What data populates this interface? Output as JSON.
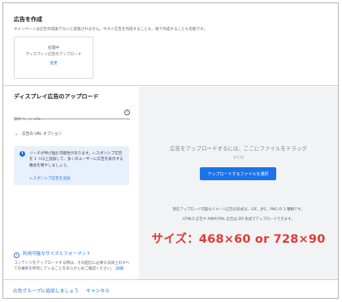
{
  "create_ad": {
    "title": "広告を作成",
    "description": "キャンペーンは広告作成後でないと実施されません。今すぐ広告を作成することも、後で作成することも可能です。",
    "card": {
      "status": "処理中",
      "type": "ディスプレイ広告のアップロード",
      "edit": "変更"
    }
  },
  "upload_panel": {
    "title": "ディスプレイ広告のアップロード",
    "url_placeholder": "最終ページ URL",
    "url_options_label": "広告の URL オプション",
    "info": {
      "text": "リーチが伸び悩む可能性があります。レスポンシブ広告を 1 つ以上追加して、多くのユーザーに広告を表示する機会を増やしましょう。",
      "link": "レスポンシブ広告を追加"
    },
    "sizes_link": "利用可能なサイズとフォーマット",
    "sizes_desc": "コンテンツをアップロードする際は、その配信に必要な法律上のすべての権利を所有していることをあらかじめご確認ください。",
    "sizes_more": "詳細"
  },
  "dropzone": {
    "title": "広告をアップロードするには、ここにファイルをドラッグ",
    "or": "または",
    "button": "アップロードするファイルを選択",
    "formats_line1": "現在アップロード可能なイメージ広告の形式は、GIF、JPG、PNG の 3 種類です。",
    "formats_line2": "HTML5 広告や AMPHTML 広告は ZIP 形式でアップロードできます。",
    "size_note": "サイズ：468×60 or 728×90"
  },
  "footer": {
    "add_label": "広告グループに追加しましょう",
    "cancel_label": "キャンセル"
  },
  "icons": {
    "help": "help-icon",
    "chevron": "chevron-down-icon",
    "info": "info-icon"
  },
  "colors": {
    "accent": "#1a73e8",
    "note_red": "#e53935",
    "dropzone_bg": "#f1f3f4",
    "info_bg": "#e8f0fe"
  }
}
